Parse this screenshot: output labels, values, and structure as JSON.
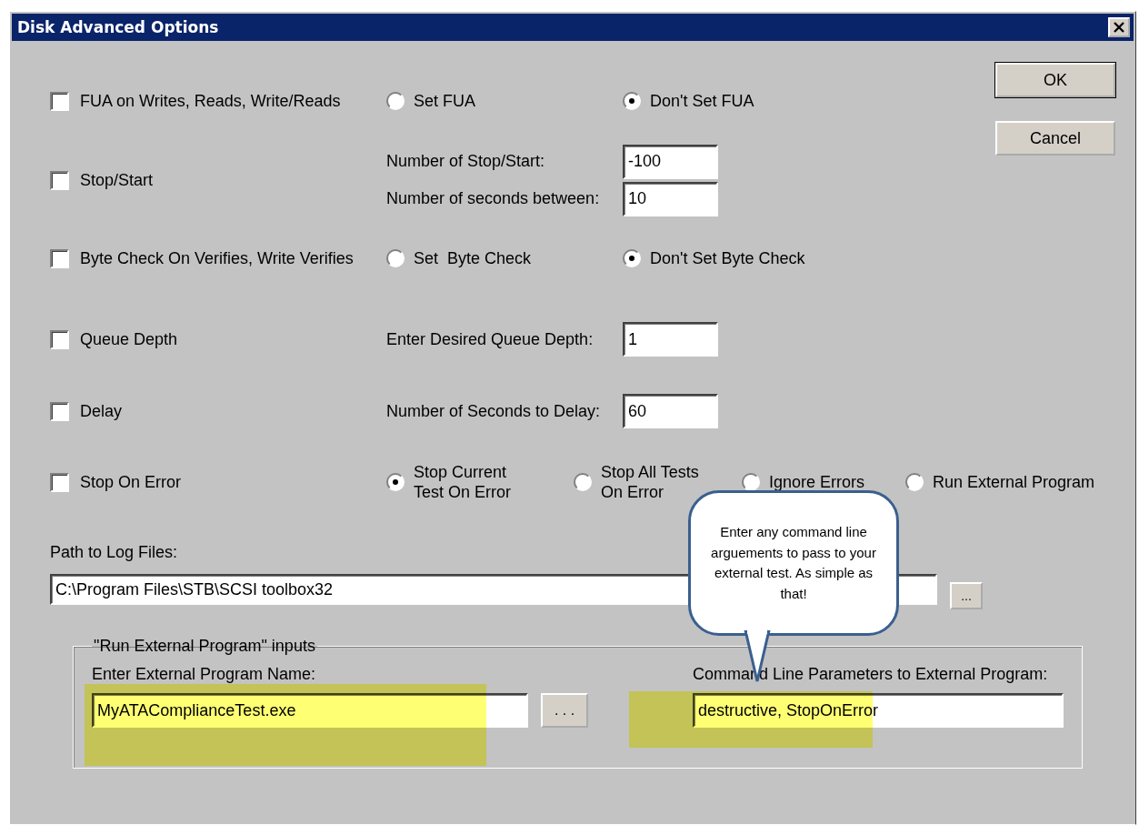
{
  "window": {
    "title": "Disk Advanced Options"
  },
  "buttons": [
    {
      "label": "OK",
      "default": true
    },
    {
      "label": "Cancel",
      "default": false
    }
  ],
  "options": [
    {
      "kind": "radios",
      "label": "FUA on Writes, Reads, Write/Reads",
      "checked": false,
      "radios": [
        {
          "label": "Set FUA",
          "selected": false
        },
        {
          "label": "Don't Set FUA",
          "selected": true
        }
      ]
    },
    {
      "kind": "fields",
      "label": "Stop/Start",
      "checked": false,
      "fields": [
        {
          "label": "Number of Stop/Start:",
          "value": "-100"
        },
        {
          "label": "Number of seconds between:",
          "value": "10"
        }
      ]
    },
    {
      "kind": "radios",
      "label": "Byte Check On Verifies, Write Verifies",
      "checked": false,
      "radios": [
        {
          "label": "Set  Byte Check",
          "selected": false
        },
        {
          "label": "Don't Set Byte Check",
          "selected": true
        }
      ]
    },
    {
      "kind": "fields",
      "label": "Queue Depth",
      "checked": false,
      "fields": [
        {
          "label": "Enter Desired Queue Depth:",
          "value": "1"
        }
      ]
    },
    {
      "kind": "fields",
      "label": "Delay",
      "checked": false,
      "fields": [
        {
          "label": "Number of Seconds to Delay:",
          "value": "60"
        }
      ]
    },
    {
      "kind": "radios",
      "label": "Stop On Error",
      "checked": false,
      "radios": [
        {
          "label": "Stop Current\nTest On Error",
          "selected": true
        },
        {
          "label": "Stop All Tests\nOn Error",
          "selected": false
        },
        {
          "label": "Ignore Errors",
          "selected": false
        },
        {
          "label": "Run External Program",
          "selected": false
        }
      ]
    }
  ],
  "log_path": {
    "label": "Path to Log Files:",
    "value": "C:\\Program Files\\STB\\SCSI toolbox32",
    "browse": "..."
  },
  "external": {
    "title": "\"Run External Program\" inputs",
    "program_label": "Enter External Program Name:",
    "program_value": "MyATAComplianceTest.exe",
    "browse": ". . .",
    "params_label": "Command Line Parameters to External Program:",
    "params_value": "destructive, StopOnError"
  },
  "callout": {
    "text": "Enter any command line arguements to pass to your external test. As simple as that!"
  }
}
